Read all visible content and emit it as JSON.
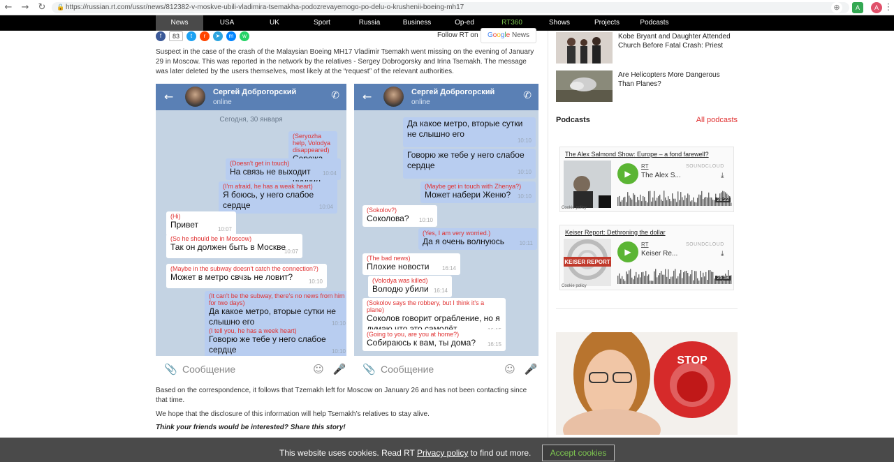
{
  "browser": {
    "url": "https://russian.rt.com/ussr/news/812382-v-moskve-ubili-vladimira-tsemakha-podozrevayemogo-po-delu-o-krushenii-boeing-mh17",
    "profile_initial": "A"
  },
  "nav": {
    "items": [
      "News",
      "USA",
      "UK",
      "Sport",
      "Russia",
      "Business",
      "Op-ed",
      "RT360",
      "Shows",
      "Projects",
      "Podcasts"
    ],
    "active": "News"
  },
  "share": {
    "count": "83",
    "follow_label": "Follow RT on",
    "google_news": [
      "G",
      "o",
      "o",
      "g",
      "l",
      "e",
      " News"
    ]
  },
  "article": {
    "lead": "Suspect in the case of the crash of the Malaysian Boeing MH17 Vladimir Tsemakh went missing on the evening of January 29 in Moscow. This was reported in the network by the relatives - Sergey Dobrogorsky and Irina Tsemakh. The message was later deleted by the users themselves, most likely at the “request” of the relevant authorities.",
    "p1": "Based on the correspondence, it follows that Tzemakh left for Moscow on January 26 and has not been contacting since that time.",
    "p2": "We hope that the disclosure of this information will help Tsemakh’s relatives to stay alive.",
    "share_story": "Think your friends would be interested? Share this story!"
  },
  "chat": {
    "contact": "Сергей Доброгорский",
    "status": "online",
    "date": "Сегодня, 30 января",
    "input_placeholder": "Сообщение",
    "left": [
      {
        "dir": "out",
        "tr": "(Seryozha help, Volodya disappeared)",
        "text": "Сережа помоги, пропал Володя",
        "time": "10:04"
      },
      {
        "dir": "out",
        "tr": "(Doesn't get in touch)",
        "text": "На связь не выходит",
        "time": "10:04"
      },
      {
        "dir": "out",
        "tr": "(I'm afraid, he has a weak heart)",
        "text": "Я боюсь, у него слабое сердце",
        "time": "10:04"
      },
      {
        "dir": "in",
        "tr": "(Hi)",
        "text": "Привет",
        "time": "10:07"
      },
      {
        "dir": "in",
        "tr": "(So he should be in Moscow)",
        "text": "Так он должен быть в Москве",
        "time": "10:07"
      },
      {
        "dir": "in",
        "tr": "(Maybe in the subway doesn't catch the connection?)",
        "text": "Может в метро свчзь не ловит?",
        "time": "10:10"
      },
      {
        "dir": "out",
        "tr": "(It can't be the subway, there's no news from him for two days)",
        "text": "Да какое метро, вторые сутки не слышно его",
        "time": "10:10"
      },
      {
        "dir": "out",
        "tr": "(I tell you, he has a week heart)",
        "text": "Говорю же тебе у него слабое сердце",
        "time": "10:10"
      }
    ],
    "right": [
      {
        "dir": "out",
        "tr": "",
        "text": "Да какое метро, вторые сутки не слышно его",
        "time": "10:10"
      },
      {
        "dir": "out",
        "tr": "",
        "text": "Говорю же тебе у него слабое сердце",
        "time": "10:10"
      },
      {
        "dir": "out",
        "tr": "(Maybe get in touch with Zhenya?)",
        "text": "Может набери Женю?",
        "time": "10:10"
      },
      {
        "dir": "in",
        "tr": "(Sokolov?)",
        "text": "Соколова?",
        "time": "10:10"
      },
      {
        "dir": "out",
        "tr": "(Yes, I am very worried.)",
        "text": "Да я очень волнуюсь",
        "time": "10:11"
      },
      {
        "dir": "in",
        "tr": "(The bad news)",
        "text": "Плохие новости",
        "time": "16:14"
      },
      {
        "dir": "in",
        "tr": "(Volodya was killed)",
        "text": "Володю убили",
        "time": "16:14"
      },
      {
        "dir": "in",
        "tr": "(Sokolov says the robbery, but I think it's a plane)",
        "text": "Соколов говорит ограбление, но я думаю что это самолёт",
        "time": "16:15"
      },
      {
        "dir": "in",
        "tr": "(Going to you, are you at home?)",
        "text": "Собираюсь к вам, ты дома?",
        "time": "16:15"
      }
    ]
  },
  "sidebar": {
    "related": [
      {
        "title": "Kobe Bryant and Daughter Attended Church Before Fatal Crash: Priest"
      },
      {
        "title": "Are Helicopters More Dangerous Than Planes?"
      }
    ],
    "podcasts_heading": "Podcasts",
    "all_podcasts": "All podcasts",
    "podcasts": [
      {
        "title": "The Alex Salmond Show: Europe – a fond farewell?",
        "author": "RT",
        "name": "The Alex S...",
        "duration": "28:22",
        "cookie": "Cookie policy",
        "brand": "SOUNDCLOUD"
      },
      {
        "title": "Keiser Report: Dethroning the dollar",
        "author": "RT",
        "name": "Keiser Re...",
        "duration": "25:58",
        "cookie": "Cookie policy",
        "brand": "SOUNDCLOUD",
        "art_label": "KEISER REPORT"
      }
    ],
    "ad_text": "STOP"
  },
  "cookie": {
    "pre": "This website uses cookies. Read RT ",
    "link": "Privacy policy",
    "post": " to find out more.",
    "button": "Accept cookies"
  },
  "colors": {
    "accent": "#e03030",
    "nav_bg": "#000000",
    "chat_header": "#5a80b5",
    "chat_bg": "#c4d3e3",
    "out_bubble": "#b8cdf0",
    "green": "#5bb534"
  }
}
